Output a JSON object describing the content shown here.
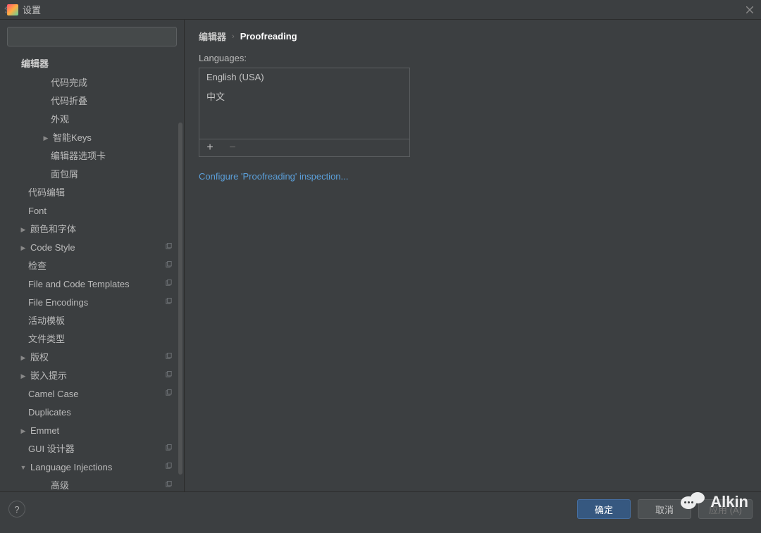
{
  "titlebar": {
    "title": "设置"
  },
  "search": {
    "placeholder": ""
  },
  "sidebar": {
    "header": "编辑器",
    "items": [
      {
        "label": "代码完成",
        "indent": 2,
        "arrow": "",
        "copy": false
      },
      {
        "label": "代码折叠",
        "indent": 2,
        "arrow": "",
        "copy": false
      },
      {
        "label": "外观",
        "indent": 2,
        "arrow": "",
        "copy": false
      },
      {
        "label": "智能Keys",
        "indent": 2,
        "arrow": "▶",
        "copy": false
      },
      {
        "label": "编辑器选项卡",
        "indent": 2,
        "arrow": "",
        "copy": false
      },
      {
        "label": "面包屑",
        "indent": 2,
        "arrow": "",
        "copy": false
      },
      {
        "label": "代码编辑",
        "indent": 1,
        "arrow": "",
        "copy": false
      },
      {
        "label": "Font",
        "indent": 1,
        "arrow": "",
        "copy": false
      },
      {
        "label": "颜色和字体",
        "indent": 1,
        "arrow": "▶",
        "copy": false
      },
      {
        "label": "Code Style",
        "indent": 1,
        "arrow": "▶",
        "copy": true
      },
      {
        "label": "检查",
        "indent": 1,
        "arrow": "",
        "copy": true
      },
      {
        "label": "File and Code Templates",
        "indent": 1,
        "arrow": "",
        "copy": true
      },
      {
        "label": "File Encodings",
        "indent": 1,
        "arrow": "",
        "copy": true
      },
      {
        "label": "活动模板",
        "indent": 1,
        "arrow": "",
        "copy": false
      },
      {
        "label": "文件类型",
        "indent": 1,
        "arrow": "",
        "copy": false
      },
      {
        "label": "版权",
        "indent": 1,
        "arrow": "▶",
        "copy": true
      },
      {
        "label": "嵌入提示",
        "indent": 1,
        "arrow": "▶",
        "copy": true
      },
      {
        "label": "Camel Case",
        "indent": 1,
        "arrow": "",
        "copy": true
      },
      {
        "label": "Duplicates",
        "indent": 1,
        "arrow": "",
        "copy": false
      },
      {
        "label": "Emmet",
        "indent": 1,
        "arrow": "▶",
        "copy": false
      },
      {
        "label": "GUI 设计器",
        "indent": 1,
        "arrow": "",
        "copy": true
      },
      {
        "label": "Language Injections",
        "indent": 1,
        "arrow": "▼",
        "copy": true
      },
      {
        "label": "高级",
        "indent": 2,
        "arrow": "",
        "copy": true
      }
    ]
  },
  "breadcrumb": {
    "item0": "编辑器",
    "item1": "Proofreading"
  },
  "content": {
    "languages_label": "Languages:",
    "languages": [
      "English (USA)",
      "中文"
    ],
    "add": "+",
    "remove": "−",
    "link": "Configure 'Proofreading' inspection..."
  },
  "footer": {
    "ok": "确定",
    "cancel": "取消",
    "apply": "应用 (A)"
  },
  "watermark": "Alkin"
}
